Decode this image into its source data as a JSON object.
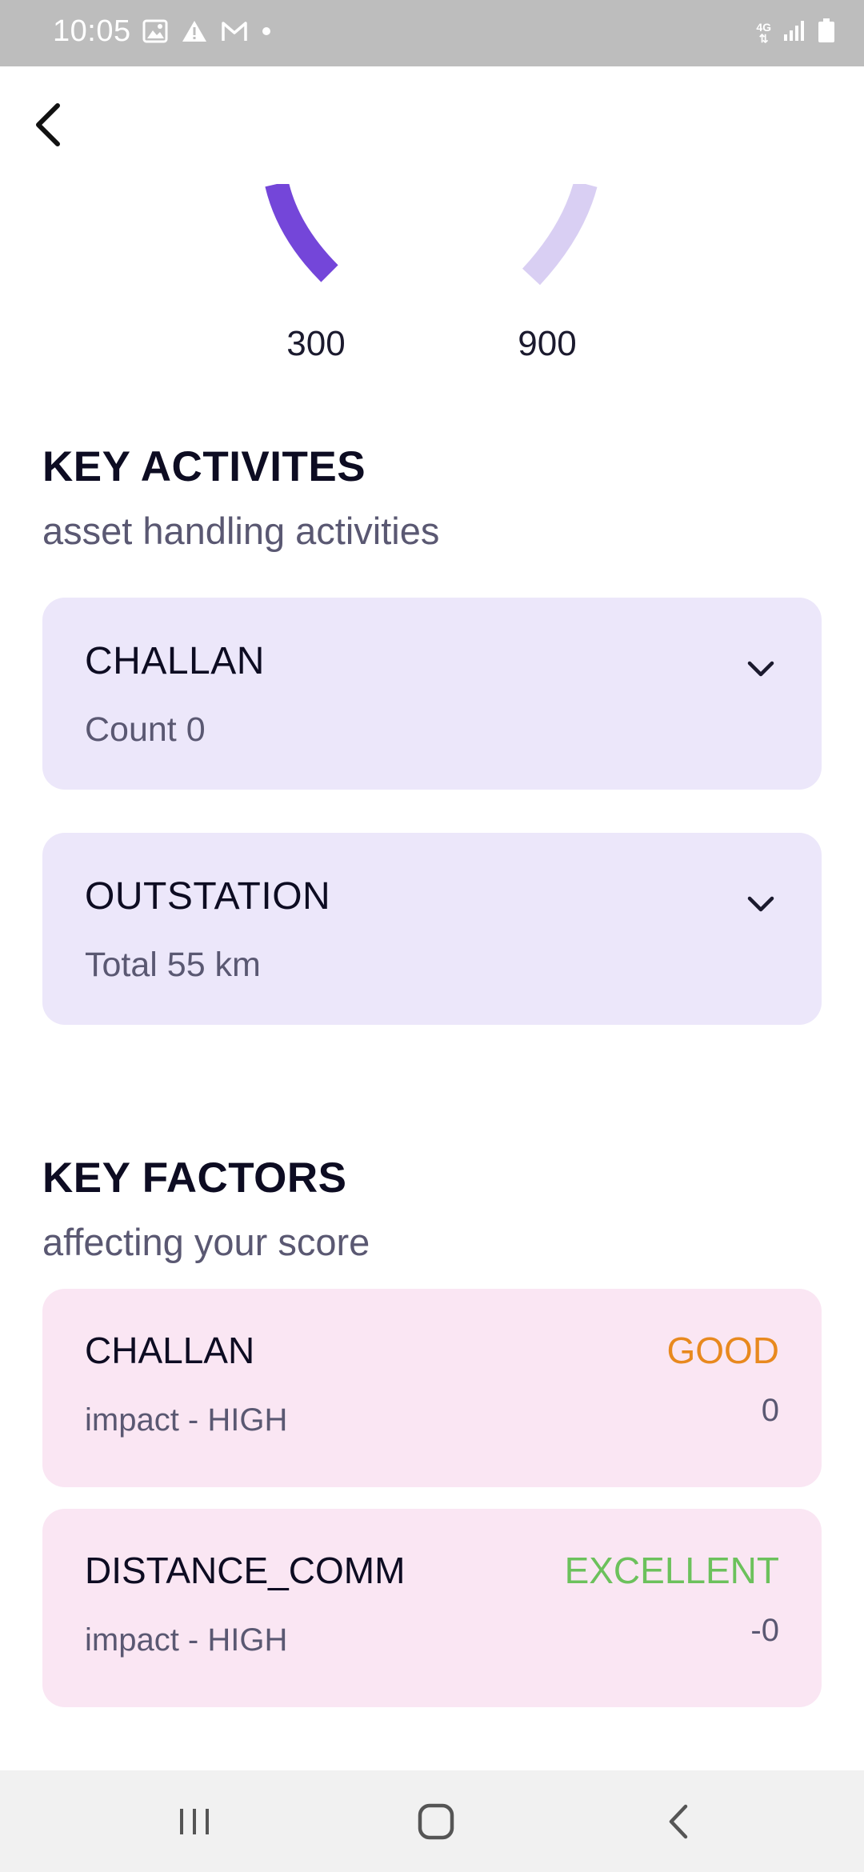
{
  "status_bar": {
    "time": "10:05",
    "network": "4G",
    "icons": [
      "image-icon",
      "warning-icon",
      "gmail-icon",
      "dot-icon",
      "signal-icon",
      "battery-icon"
    ]
  },
  "gauge": {
    "min_label": "300",
    "max_label": "900",
    "colors": {
      "filled": "#7446d9",
      "track": "#d9cff3"
    }
  },
  "key_activities": {
    "title": "KEY ACTIVITES",
    "subtitle": "asset handling activities",
    "items": [
      {
        "title": "CHALLAN",
        "detail": "Count 0"
      },
      {
        "title": "OUTSTATION",
        "detail": "Total 55 km"
      }
    ]
  },
  "key_factors": {
    "title": "KEY FACTORS",
    "subtitle": "affecting your score",
    "items": [
      {
        "title": "CHALLAN",
        "impact": "impact - HIGH",
        "rating": "GOOD",
        "rating_color": "#e8891e",
        "value": "0"
      },
      {
        "title": "DISTANCE_COMM",
        "impact": "impact - HIGH",
        "rating": "EXCELLENT",
        "rating_color": "#6cc15c",
        "value": "-0"
      }
    ]
  },
  "colors": {
    "activity_card_bg": "#ece7fa",
    "factor_card_bg": "#fae6f3",
    "good": "#e8891e",
    "excellent": "#6cc15c"
  }
}
